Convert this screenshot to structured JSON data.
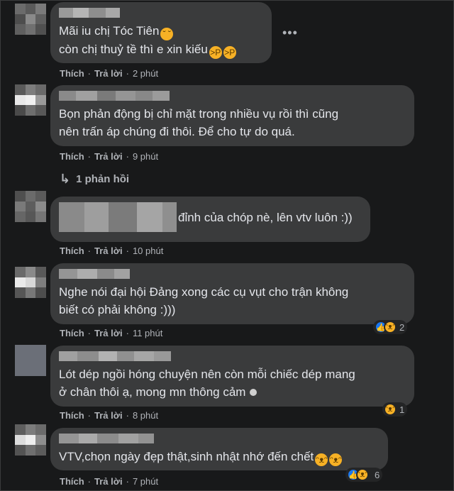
{
  "comments": [
    {
      "text_lines": [
        "Mãi iu chị Tóc Tiên",
        "còn chị thuỷ tề thì e xin kiếu"
      ],
      "like_label": "Thích",
      "reply_label": "Trả lời",
      "time": "2 phút"
    },
    {
      "text_lines": [
        "Bọn phản động bị chỉ mặt trong nhiều vụ rồi thì cũng",
        "nên trấn áp chúng đi thôi. Để cho tự do quá."
      ],
      "like_label": "Thích",
      "reply_label": "Trả lời",
      "time": "9 phút",
      "replies_label": "1 phản hồi"
    },
    {
      "text_lines": [
        "đỉnh của chóp nè, lên vtv luôn :))"
      ],
      "like_label": "Thích",
      "reply_label": "Trả lời",
      "time": "10 phút"
    },
    {
      "text_lines": [
        "Nghe nói đại hội Đảng xong các cụ vụt cho trận không",
        "biết có phải không :)))"
      ],
      "like_label": "Thích",
      "reply_label": "Trả lời",
      "time": "11 phút",
      "reaction_count": "2"
    },
    {
      "text_lines": [
        "Lót dép ngồi hóng chuyện nên còn mỗi chiếc dép mang",
        "ở chân thôi ạ, mong mn thông cảm"
      ],
      "like_label": "Thích",
      "reply_label": "Trả lời",
      "time": "8 phút",
      "reaction_count": "1"
    },
    {
      "text_lines": [
        "VTV,chọn ngày đẹp thật,sinh nhật nhớ đến chết"
      ],
      "like_label": "Thích",
      "reply_label": "Trả lời",
      "time": "7 phút",
      "reaction_count": "6"
    }
  ],
  "icons": {
    "more": "more-horizontal-icon",
    "reply_arrow": "reply-arrow-icon",
    "like": "like-reaction-icon",
    "haha": "haha-reaction-icon",
    "avatar": "pixelated-avatar"
  },
  "colors": {
    "background": "#18191a",
    "bubble": "#3a3b3c",
    "text": "#e4e6eb",
    "muted": "#b0b3b8",
    "like": "#1877f2",
    "haha": "#f7b125"
  }
}
